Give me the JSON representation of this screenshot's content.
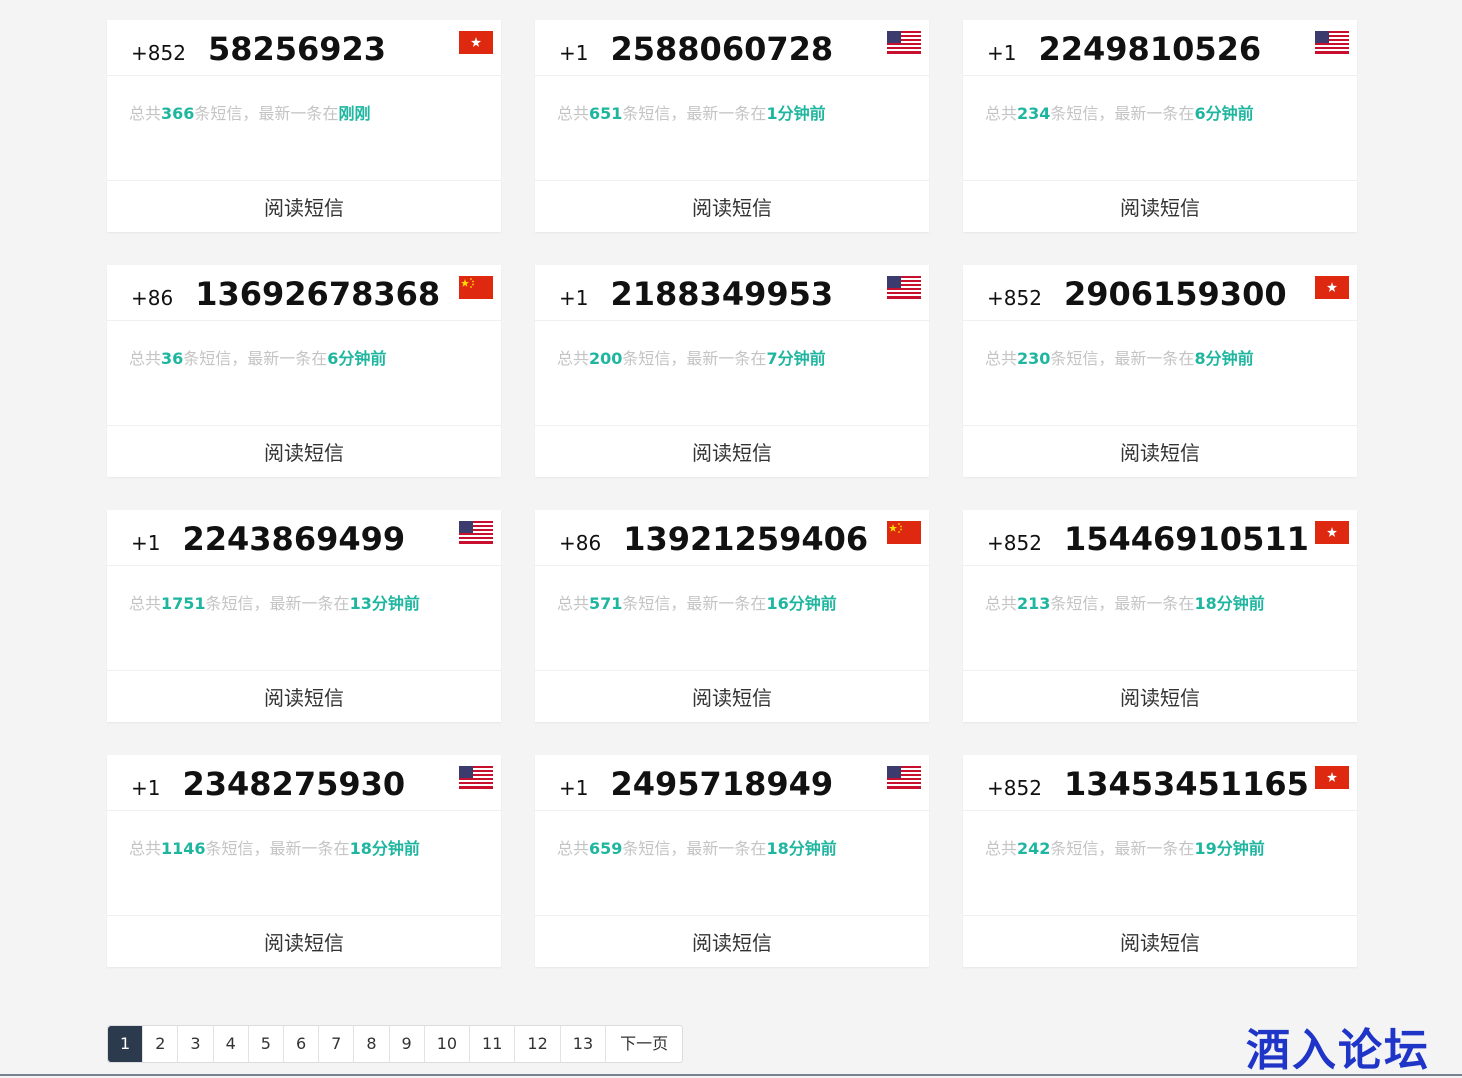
{
  "card_action_label": "阅读短信",
  "cards": [
    {
      "code": "+852",
      "number": "58256923",
      "flag": "hk-flag-icon",
      "total_prefix": "总共",
      "count": "366",
      "mid": "条短信，最新一条在",
      "time": "刚刚"
    },
    {
      "code": "+1",
      "number": "2588060728",
      "flag": "us-flag-icon",
      "total_prefix": "总共",
      "count": "651",
      "mid": "条短信，最新一条在",
      "time": "1分钟前"
    },
    {
      "code": "+1",
      "number": "2249810526",
      "flag": "us-flag-icon",
      "total_prefix": "总共",
      "count": "234",
      "mid": "条短信，最新一条在",
      "time": "6分钟前"
    },
    {
      "code": "+86",
      "number": "13692678368",
      "flag": "cn-flag-icon",
      "total_prefix": "总共",
      "count": "36",
      "mid": "条短信，最新一条在",
      "time": "6分钟前"
    },
    {
      "code": "+1",
      "number": "2188349953",
      "flag": "us-flag-icon",
      "total_prefix": "总共",
      "count": "200",
      "mid": "条短信，最新一条在",
      "time": "7分钟前"
    },
    {
      "code": "+852",
      "number": "2906159300",
      "flag": "hk-flag-icon",
      "total_prefix": "总共",
      "count": "230",
      "mid": "条短信，最新一条在",
      "time": "8分钟前"
    },
    {
      "code": "+1",
      "number": "2243869499",
      "flag": "us-flag-icon",
      "total_prefix": "总共",
      "count": "1751",
      "mid": "条短信，最新一条在",
      "time": "13分钟前"
    },
    {
      "code": "+86",
      "number": "13921259406",
      "flag": "cn-flag-icon",
      "total_prefix": "总共",
      "count": "571",
      "mid": "条短信，最新一条在",
      "time": "16分钟前"
    },
    {
      "code": "+852",
      "number": "15446910511",
      "flag": "hk-flag-icon",
      "total_prefix": "总共",
      "count": "213",
      "mid": "条短信，最新一条在",
      "time": "18分钟前"
    },
    {
      "code": "+1",
      "number": "2348275930",
      "flag": "us-flag-icon",
      "total_prefix": "总共",
      "count": "1146",
      "mid": "条短信，最新一条在",
      "time": "18分钟前"
    },
    {
      "code": "+1",
      "number": "2495718949",
      "flag": "us-flag-icon",
      "total_prefix": "总共",
      "count": "659",
      "mid": "条短信，最新一条在",
      "time": "18分钟前"
    },
    {
      "code": "+852",
      "number": "13453451165",
      "flag": "hk-flag-icon",
      "total_prefix": "总共",
      "count": "242",
      "mid": "条短信，最新一条在",
      "time": "19分钟前"
    }
  ],
  "pagination": {
    "pages": [
      "1",
      "2",
      "3",
      "4",
      "5",
      "6",
      "7",
      "8",
      "9",
      "10",
      "11",
      "12",
      "13"
    ],
    "current": "1",
    "next_label": "下一页"
  },
  "watermark": "酒入论坛",
  "colors": {
    "highlight": "#1fb6a0",
    "pager_active": "#2b3a4d",
    "watermark": "#1e35c8"
  }
}
